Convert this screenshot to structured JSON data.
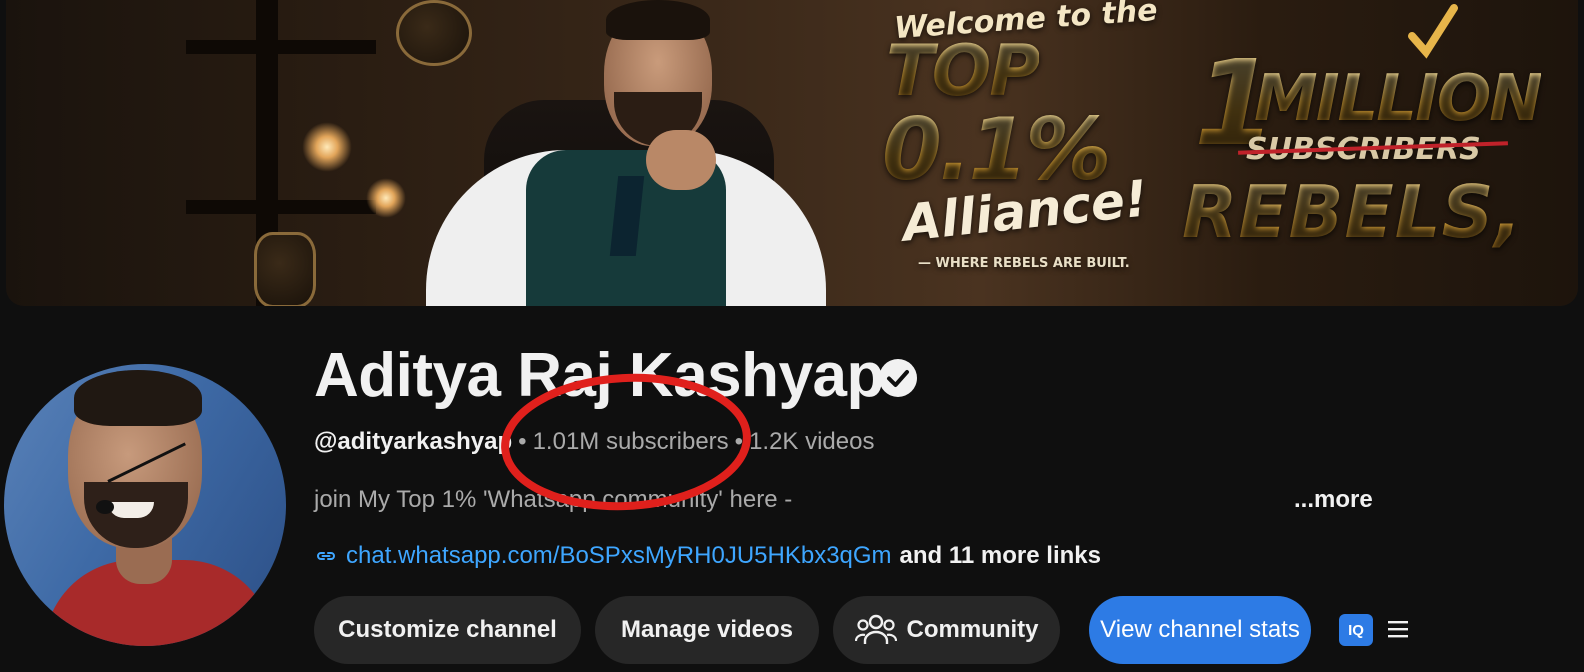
{
  "banner": {
    "welcome": "Welcome to the",
    "top": "TOP",
    "percent": "0.1%",
    "alliance": "Alliance!",
    "tagline": "— WHERE REBELS ARE BUILT.",
    "one": "1",
    "million": "MILLION",
    "subscribers_struck": "SUBSCRIBERS",
    "rebels": "REBELS,"
  },
  "channel": {
    "name": "Aditya Raj Kashyap",
    "handle": "@adityarkashyap",
    "subscribers": "1.01M subscribers",
    "videos": "1.2K videos",
    "separator": "•",
    "description": "join My Top 1% 'Whatsapp community' here -",
    "more_label": "...more",
    "link_url": "chat.whatsapp.com/BoSPxsMyRH0JU5HKbx3qGm",
    "more_links": "and 11 more links"
  },
  "buttons": {
    "customize": "Customize channel",
    "manage": "Manage videos",
    "community": "Community",
    "stats": "View channel stats",
    "extension": "IQ"
  },
  "icons": {
    "verified": "verified-check-icon",
    "link": "link-icon",
    "community": "people-icon",
    "menu": "hamburger-menu-icon"
  },
  "colors": {
    "background": "#0f0f0f",
    "link": "#3ea6ff",
    "primary_button": "#2d7be5",
    "annotation": "#e0201c"
  }
}
